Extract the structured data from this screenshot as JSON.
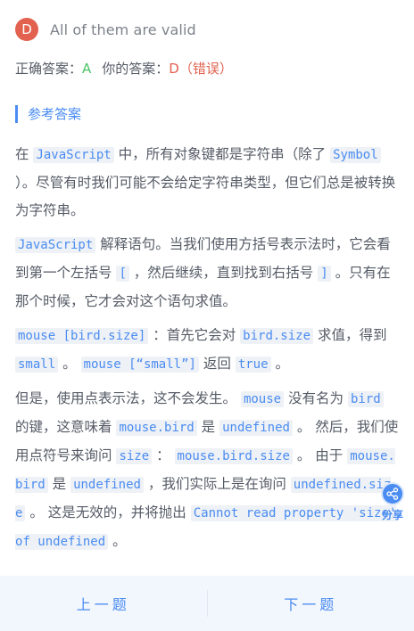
{
  "option": {
    "letter": "D",
    "text": "All of them are valid"
  },
  "answer": {
    "correct_label": "正确答案：",
    "correct_value": "A",
    "yours_label": "你的答案：",
    "yours_value": "D（错误）"
  },
  "reference_title": "参考答案",
  "content": {
    "p1": {
      "t1": "在 ",
      "c1": "JavaScript",
      "t2": " 中，所有对象键都是字符串（除了 ",
      "c2": "Symbol",
      "t3": " ）。尽管有时我们可能不会给定字符串类型，但它们总是被转换为字符串。"
    },
    "p2": {
      "c1": "JavaScript",
      "t1": " 解释语句。当我们使用方括号表示法时，它会看到第一个左括号 ",
      "c2": "[",
      "t2": " ，然后继续，直到找到右括号 ",
      "c3": "]",
      "t3": " 。只有在那个时候，它才会对这个语句求值。"
    },
    "p3": {
      "c1": "mouse [bird.size]",
      "t1": " ：首先它会对 ",
      "c2": "bird.size",
      "t2": " 求值，得到 ",
      "c3": "small",
      "t3": " 。 ",
      "c4": "mouse [“small”]",
      "t4": " 返回 ",
      "c5": "true",
      "t5": " 。"
    },
    "p4": {
      "t1": "但是，使用点表示法，这不会发生。 ",
      "c1": "mouse",
      "t2": " 没有名为 ",
      "c2": "bird",
      "t3": " 的键，这意味着 ",
      "c3": "mouse.bird",
      "t4": " 是 ",
      "c4": "undefined",
      "t5": " 。 然后，我们使用点符号来询问 ",
      "c5": "size",
      "t6": " ： ",
      "c6": "mouse.bird.size",
      "t7": " 。 由于 ",
      "c7": "mouse.bird",
      "t8": " 是 ",
      "c8": "undefined",
      "t9": " ，我们实际上是在询问 ",
      "c9": "undefined.size",
      "t10": " 。 这是无效的，并将抛出 ",
      "c10": "Cannot read property 'size' of undefined",
      "t11": " 。"
    }
  },
  "share_label": "分享",
  "nav": {
    "prev": "上一题",
    "next": "下一题"
  },
  "colors": {
    "accent": "#4a8cf2",
    "error": "#e2614f",
    "success": "#4dc366"
  },
  "icons": {
    "share": "share-icon"
  }
}
